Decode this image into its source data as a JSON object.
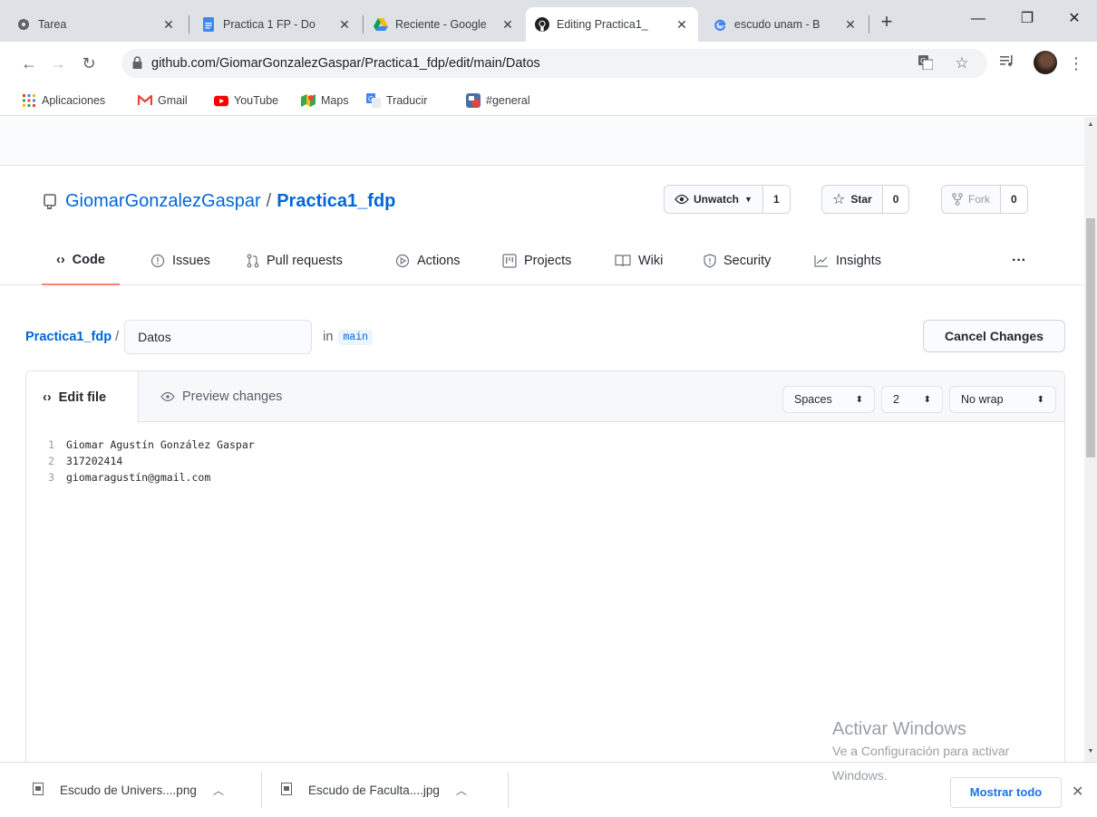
{
  "browser": {
    "tabs": [
      {
        "title": "Tarea",
        "favicon": "globe-icon"
      },
      {
        "title": "Practica 1 FP - Do",
        "favicon": "google-docs-icon"
      },
      {
        "title": "Reciente - Google",
        "favicon": "google-drive-icon"
      },
      {
        "title": "Editing Practica1_",
        "favicon": "github-icon"
      },
      {
        "title": "escudo unam - B",
        "favicon": "google-icon"
      }
    ],
    "url_host": "github.com",
    "url_path": "/GiomarGonzalezGaspar/Practica1_fdp/edit/main/Datos",
    "bookmarks": [
      "Aplicaciones",
      "Gmail",
      "YouTube",
      "Maps",
      "Traducir",
      "#general"
    ]
  },
  "repo": {
    "owner": "GiomarGonzalezGaspar",
    "separator": "/",
    "name": "Practica1_fdp",
    "unwatch_label": "Unwatch",
    "unwatch_count": "1",
    "star_label": "Star",
    "star_count": "0",
    "fork_label": "Fork",
    "fork_count": "0"
  },
  "nav": {
    "tabs": [
      "Code",
      "Issues",
      "Pull requests",
      "Actions",
      "Projects",
      "Wiki",
      "Security",
      "Insights"
    ],
    "more": "···"
  },
  "editor_header": {
    "repo_link": "Practica1_fdp",
    "separator": "/",
    "filename": "Datos",
    "in_label": "in",
    "branch": "main",
    "cancel_label": "Cancel Changes"
  },
  "editor": {
    "edit_tab": "Edit file",
    "preview_tab": "Preview changes",
    "indent_mode": "Spaces",
    "indent_size": "2",
    "wrap_mode": "No wrap",
    "lines": [
      {
        "n": "1",
        "text": "Giomar Agustín González Gaspar"
      },
      {
        "n": "2",
        "text": "317202414"
      },
      {
        "n": "3",
        "text": "giomaragustín@gmail.com"
      }
    ]
  },
  "watermark": {
    "title": "Activar Windows",
    "line1": "Ve a Configuración para activar",
    "line2": "Windows."
  },
  "downloads": {
    "items": [
      "Escudo de Univers....png",
      "Escudo de Faculta....jpg"
    ],
    "show_all": "Mostrar todo"
  }
}
